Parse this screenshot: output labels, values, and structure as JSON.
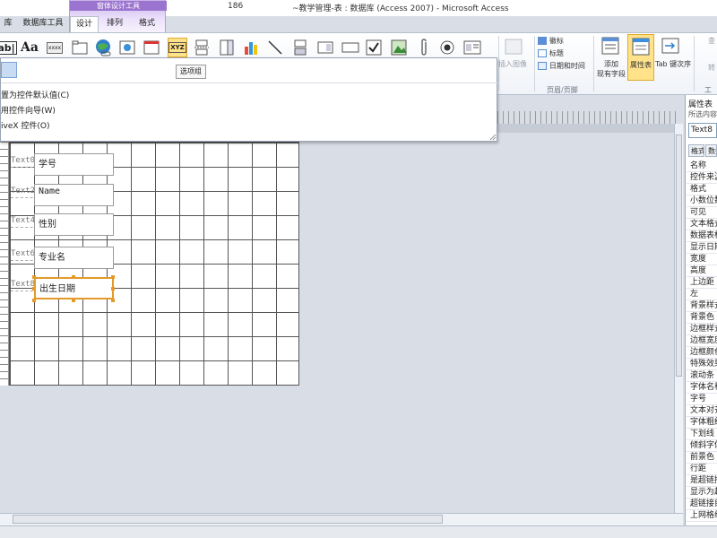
{
  "window": {
    "title_left_fragment": "186",
    "title": "~教学管理-表 : 数据库 (Access 2007)  -  Microsoft Access",
    "context_group": "窗体设计工具"
  },
  "tabs": [
    {
      "label": "库"
    },
    {
      "label": "数据库工具"
    },
    {
      "label": "设计",
      "active": true
    },
    {
      "label": "排列"
    },
    {
      "label": "格式"
    }
  ],
  "ribbon": {
    "controls": [
      {
        "label": "ab|",
        "icon": "textbox-icon"
      },
      {
        "label": "Aa",
        "icon": "label-icon"
      },
      {
        "label": "xxxx",
        "icon": "button-icon"
      },
      {
        "label": "",
        "icon": "tab-control-icon"
      },
      {
        "label": "",
        "icon": "hyperlink-icon"
      },
      {
        "label": "",
        "icon": "web-browser-icon"
      },
      {
        "label": "",
        "icon": "navigation-icon"
      },
      {
        "label": "XYZ",
        "icon": "option-group-icon",
        "highlighted": true
      },
      {
        "label": "",
        "icon": "page-break-icon"
      },
      {
        "label": "",
        "icon": "combo-box-icon"
      },
      {
        "label": "",
        "icon": "chart-icon"
      },
      {
        "label": "",
        "icon": "line-icon"
      },
      {
        "label": "",
        "icon": "toggle-button-icon"
      },
      {
        "label": "",
        "icon": "list-box-icon"
      },
      {
        "label": "",
        "icon": "rectangle-icon"
      },
      {
        "label": "",
        "icon": "checkbox-icon"
      },
      {
        "label": "",
        "icon": "unbound-object-icon"
      },
      {
        "label": "",
        "icon": "attachment-icon"
      },
      {
        "label": "",
        "icon": "option-button-icon"
      },
      {
        "label": "",
        "icon": "subform-icon"
      }
    ],
    "insert_image": "插入图像",
    "header_footer": {
      "items": [
        "徽标",
        "标题",
        "日期和时间"
      ],
      "group_label": "页眉/页脚"
    },
    "add_existing_fields": "添加\n现有字段",
    "property_sheet": "属性表",
    "tab_order": "Tab 键次序",
    "tools_fragment_1": "查",
    "tools_fragment_2": "转",
    "tools_group_label": "工具"
  },
  "tooltip": "选项组",
  "dropdown_menu": [
    "置为控件默认值(C)",
    "用控件向导(W)",
    "iveX 控件(O)"
  ],
  "form": {
    "fields": [
      {
        "label": "Text0",
        "value": "学号",
        "selected": false
      },
      {
        "label": "Text2",
        "value": "Name",
        "selected": false
      },
      {
        "label": "Text4",
        "value": "性别",
        "selected": false
      },
      {
        "label": "Text6",
        "value": "专业名",
        "selected": false
      },
      {
        "label": "Text8",
        "value": "出生日期",
        "selected": true
      }
    ]
  },
  "property_sheet": {
    "title": "属性表",
    "subtitle": "所选内容",
    "selected": "Text8",
    "tabs": [
      "格式",
      "数据"
    ],
    "properties": [
      "名称",
      "控件来源",
      "格式",
      "小数位数",
      "可见",
      "文本格式",
      "数据表标题",
      "显示日期",
      "宽度",
      "高度",
      "上边距",
      "左",
      "背景样式",
      "背景色",
      "边框样式",
      "边框宽度",
      "边框颜色",
      "特殊效果",
      "滚动条",
      "字体名称",
      "字号",
      "文本对齐",
      "字体粗细",
      "下划线",
      "倾斜字体",
      "前景色",
      "行距",
      "是超链接",
      "显示为超",
      "超链接目标",
      "上网格线"
    ]
  }
}
